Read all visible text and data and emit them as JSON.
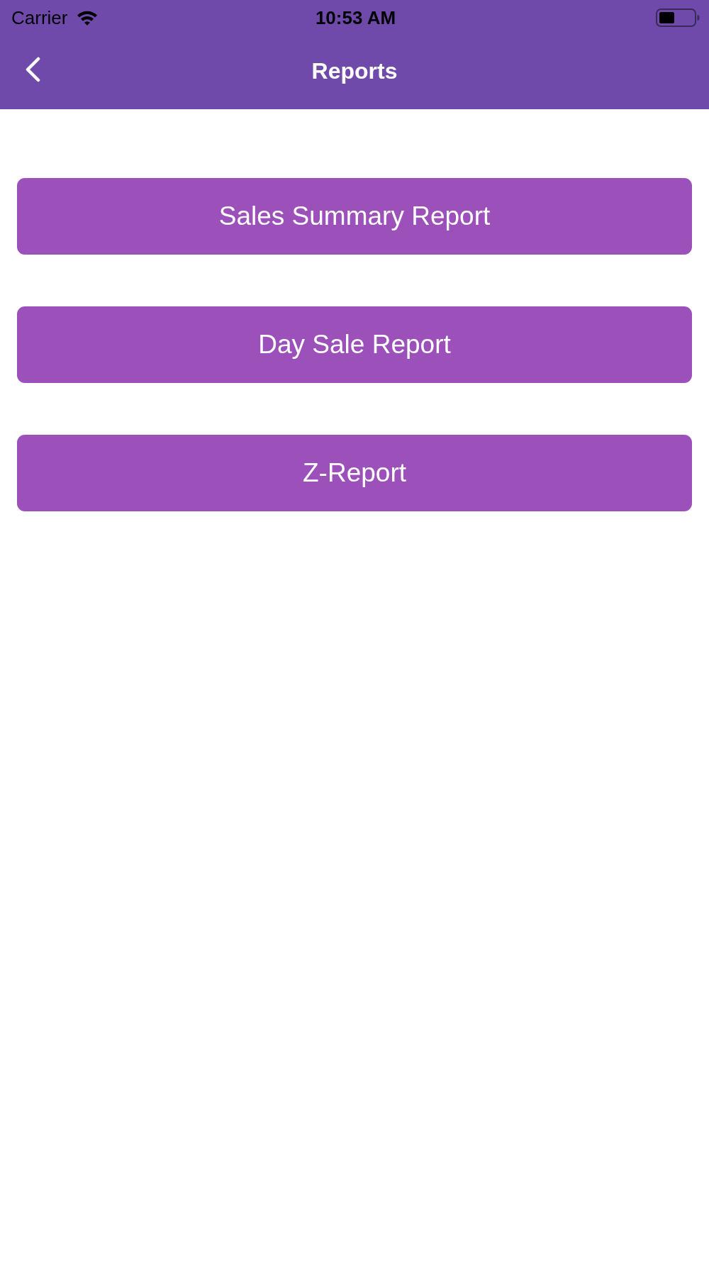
{
  "status_bar": {
    "carrier": "Carrier",
    "time": "10:53 AM"
  },
  "nav_bar": {
    "title": "Reports"
  },
  "buttons": [
    {
      "label": "Sales Summary Report"
    },
    {
      "label": "Day Sale Report"
    },
    {
      "label": "Z-Report"
    }
  ]
}
